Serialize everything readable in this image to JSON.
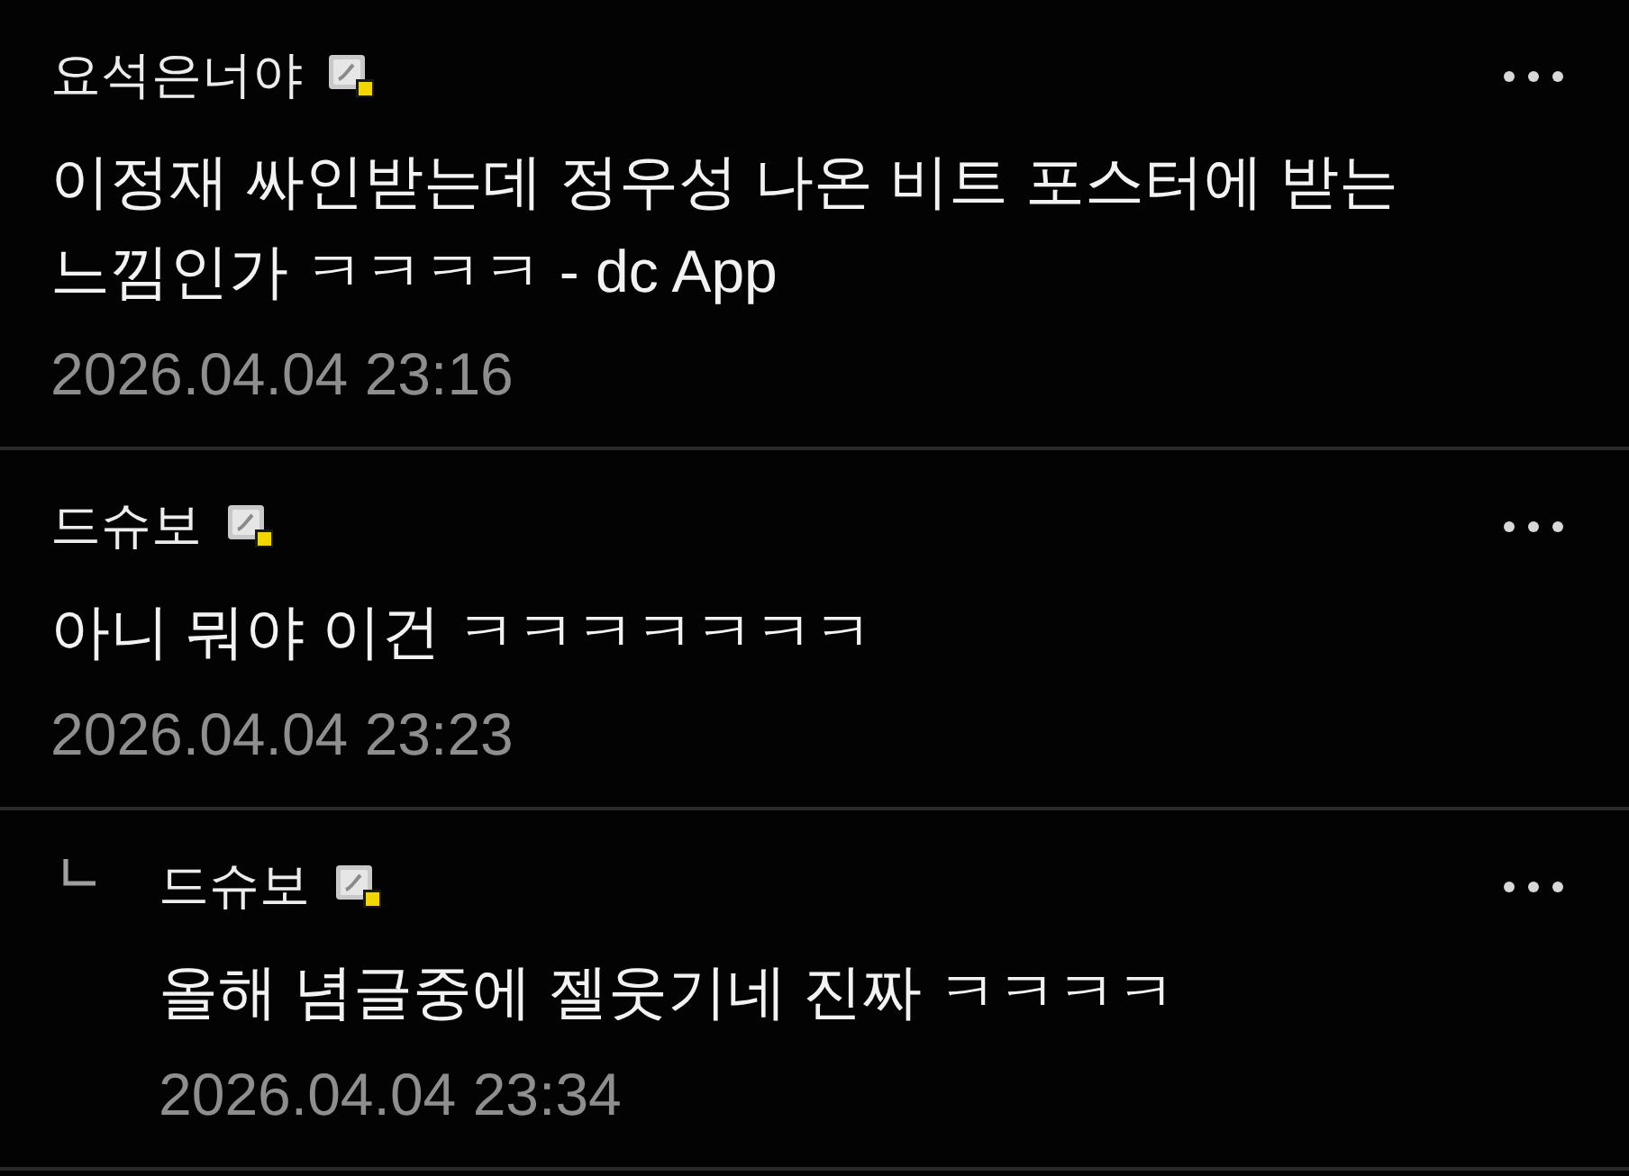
{
  "comments": [
    {
      "author": "요석은너야",
      "text": "이정재 싸인받는데 정우성 나온 비트 포스터에 받는 느낌인가 ㅋㅋㅋㅋ - dc App",
      "time": "2026.04.04 23:16"
    },
    {
      "author": "드슈보",
      "text": "아니 뭐야 이건 ㅋㅋㅋㅋㅋㅋㅋ",
      "time": "2026.04.04 23:23",
      "children": [
        {
          "author": "드슈보",
          "text": "올해 념글중에 젤웃기네 진짜 ㅋㅋㅋㅋ",
          "time": "2026.04.04 23:34"
        }
      ]
    }
  ]
}
